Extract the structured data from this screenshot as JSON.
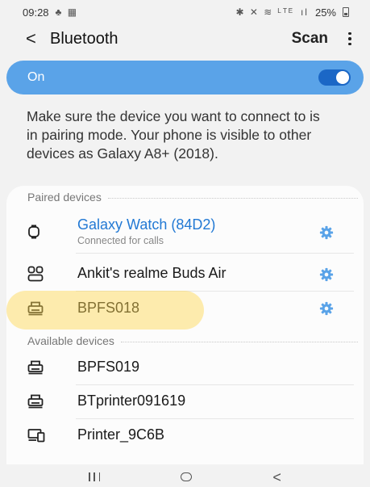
{
  "status_bar": {
    "time": "09:28",
    "left_icons": "♣ ▦",
    "right_icons": "✱ ✕ ≋ ᴸᵀᴱ",
    "signal": "ıl",
    "battery": "25%"
  },
  "app_bar": {
    "back_icon": "back-chevron-icon",
    "title": "Bluetooth",
    "scan_label": "Scan",
    "more_icon": "more-vertical-icon"
  },
  "toggle": {
    "label": "On",
    "state": true,
    "accent_color": "#5aa3e8"
  },
  "info_text": "Make sure the device you want to connect to is in pairing mode. Your phone is visible to other devices as Galaxy A8+ (2018).",
  "paired": {
    "header": "Paired devices",
    "devices": [
      {
        "name": "Galaxy Watch (84D2)",
        "subtitle": "Connected for calls",
        "icon": "watch-icon",
        "connected": true
      },
      {
        "name": "Ankit's realme Buds Air",
        "icon": "earbuds-icon",
        "connected": false
      },
      {
        "name": "BPFS018",
        "icon": "printer-icon",
        "connected": false
      }
    ]
  },
  "available": {
    "header": "Available devices",
    "devices": [
      {
        "name": "BPFS019",
        "icon": "printer-icon"
      },
      {
        "name": "BTprinter091619",
        "icon": "printer-icon"
      },
      {
        "name": "Printer_9C6B",
        "icon": "devices-icon"
      }
    ]
  },
  "nav": {
    "recent": "recent-apps-icon",
    "home": "home-icon",
    "back": "back-icon"
  }
}
